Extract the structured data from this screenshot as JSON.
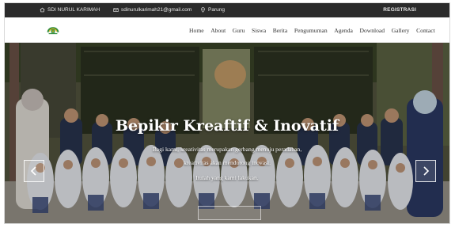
{
  "topbar": {
    "school_name": "SDI NURUL KARIMAH",
    "email": "sdinurulkarimah21@gmail.com",
    "location": "Parung",
    "register_label": "REGISTRASI",
    "icons": [
      "home-icon",
      "envelope-icon",
      "location-pin-icon"
    ]
  },
  "navbar": {
    "logo_icon": "school-emblem-logo",
    "menu": [
      "Home",
      "About",
      "Guru",
      "Siswa",
      "Berita",
      "Pengumuman",
      "Agenda",
      "Download",
      "Gallery",
      "Contact"
    ]
  },
  "hero": {
    "title": "Bepikir Kreaftif & Inovatif",
    "subtitle_line1": "Bagi kami, kreativitas merupakan gerbang menuju peradaban,",
    "subtitle_line2": "kreativitas akan mendorong inovasi.",
    "subtitle_line3": "Itulah yang kami lakukan.",
    "prev_icon": "chevron-left-icon",
    "next_icon": "chevron-right-icon"
  },
  "colors": {
    "topbar_bg": "#2b2b2b",
    "logo_green": "#2e8b3a",
    "logo_gold": "#d8b21e"
  }
}
